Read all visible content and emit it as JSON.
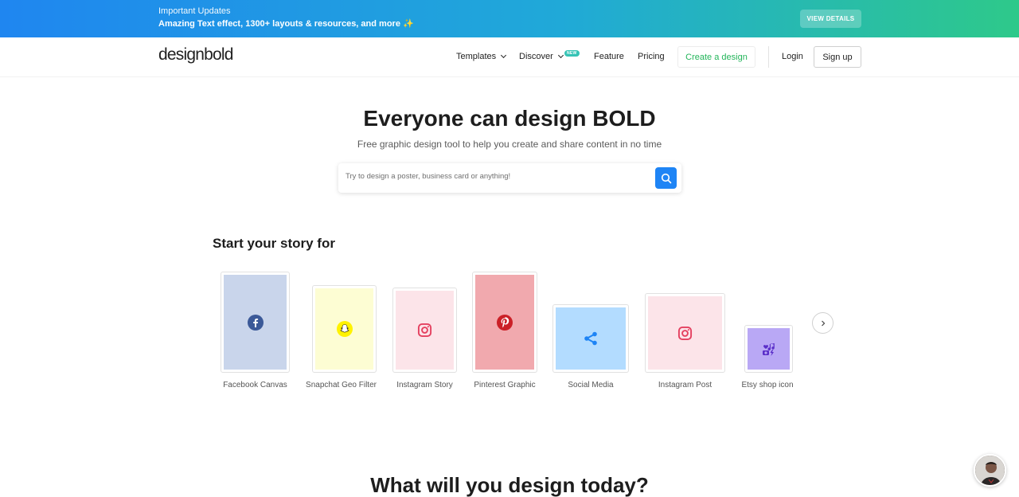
{
  "banner": {
    "title": "Important Updates",
    "subtitle": "Amazing Text effect, 1300+ layouts & resources, and more",
    "spark": "✨",
    "button": "VIEW DETAILS"
  },
  "nav": {
    "logo": "designbold",
    "templates": "Templates",
    "discover": "Discover",
    "new_badge": "NEW",
    "feature": "Feature",
    "pricing": "Pricing",
    "create": "Create a design",
    "login": "Login",
    "signup": "Sign up"
  },
  "hero": {
    "title": "Everyone can design BOLD",
    "subtitle": "Free graphic design tool to help you create and share content in no time",
    "search_placeholder": "Try to design a poster, business card or anything!"
  },
  "story": {
    "title": "Start your story for",
    "cards": [
      {
        "label": "Facebook Canvas",
        "icon": "facebook-icon",
        "bg": "#c9d5eb",
        "accent": "#3b5998"
      },
      {
        "label": "Snapchat Geo Filter",
        "icon": "snapchat-icon",
        "bg": "#fdfdd3",
        "accent": "#fff200"
      },
      {
        "label": "Instagram Story",
        "icon": "instagram-icon",
        "bg": "#fce4e9",
        "accent": "#e4405f"
      },
      {
        "label": "Pinterest Graphic",
        "icon": "pinterest-icon",
        "bg": "#f1a9ae",
        "accent": "#cb2027"
      },
      {
        "label": "Social Media",
        "icon": "share-icon",
        "bg": "#b3dcff",
        "accent": "#1e84f5"
      },
      {
        "label": "Instagram Post",
        "icon": "instagram-icon",
        "bg": "#fce4e9",
        "accent": "#e4405f"
      },
      {
        "label": "Etsy shop icon",
        "icon": "shop-music-icon",
        "bg": "#b9a8f5",
        "accent": "#5b2fc9"
      }
    ]
  },
  "bottom": {
    "title": "What will you design today?"
  },
  "colors": {
    "primary": "#1e84f5",
    "green": "#23b55a"
  }
}
